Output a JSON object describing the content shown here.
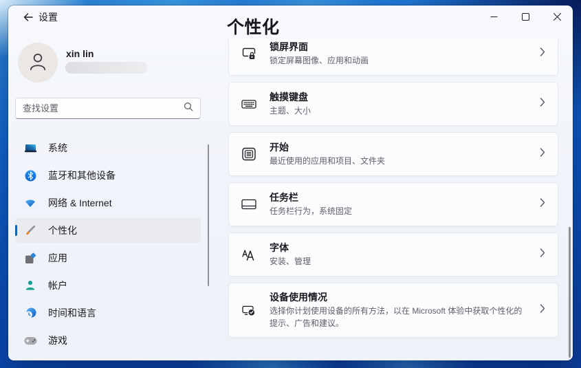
{
  "window": {
    "title": "设置",
    "controls": [
      {
        "id": "minimize",
        "icon": "minimize-icon"
      },
      {
        "id": "maximize",
        "icon": "maximize-icon"
      },
      {
        "id": "close",
        "icon": "close-icon"
      }
    ]
  },
  "user": {
    "name": "xin lin",
    "email_masked": true,
    "avatar_icon": "person-icon"
  },
  "search": {
    "placeholder": "查找设置",
    "icon": "search-icon"
  },
  "sidebar": {
    "selected_index": 3,
    "items": [
      {
        "id": "system",
        "label": "系统",
        "icon": "system-icon"
      },
      {
        "id": "bluetooth",
        "label": "蓝牙和其他设备",
        "icon": "bluetooth-icon"
      },
      {
        "id": "network",
        "label": "网络 & Internet",
        "icon": "network-icon"
      },
      {
        "id": "personalization",
        "label": "个性化",
        "icon": "personalization-icon"
      },
      {
        "id": "apps",
        "label": "应用",
        "icon": "apps-icon"
      },
      {
        "id": "accounts",
        "label": "帐户",
        "icon": "accounts-icon"
      },
      {
        "id": "time-language",
        "label": "时间和语言",
        "icon": "time-language-icon"
      },
      {
        "id": "gaming",
        "label": "游戏",
        "icon": "gaming-icon"
      }
    ]
  },
  "main": {
    "title": "个性化",
    "cards": [
      {
        "id": "lock-screen",
        "icon": "lock-screen-icon",
        "title": "锁屏界面",
        "subtitle": "锁定屏幕图像、应用和动画",
        "tall": false
      },
      {
        "id": "touch-keyboard",
        "icon": "touch-keyboard-icon",
        "title": "触摸键盘",
        "subtitle": "主题、大小",
        "tall": false
      },
      {
        "id": "start",
        "icon": "start-icon",
        "title": "开始",
        "subtitle": "最近使用的应用和项目、文件夹",
        "tall": false
      },
      {
        "id": "taskbar",
        "icon": "taskbar-icon",
        "title": "任务栏",
        "subtitle": "任务栏行为，系统固定",
        "tall": false
      },
      {
        "id": "fonts",
        "icon": "fonts-icon",
        "title": "字体",
        "subtitle": "安装、管理",
        "tall": false
      },
      {
        "id": "device-usage",
        "icon": "device-usage-icon",
        "title": "设备使用情况",
        "subtitle": "选择你计划使用设备的所有方法，以在 Microsoft 体验中获取个性化的提示、广告和建议。",
        "tall": true
      }
    ]
  },
  "colors": {
    "accent": "#0067c0",
    "card_bg": "#fbfcfd",
    "window_bg": "#f1f4fa",
    "wallpaper_blue": "#0b4fb8"
  }
}
